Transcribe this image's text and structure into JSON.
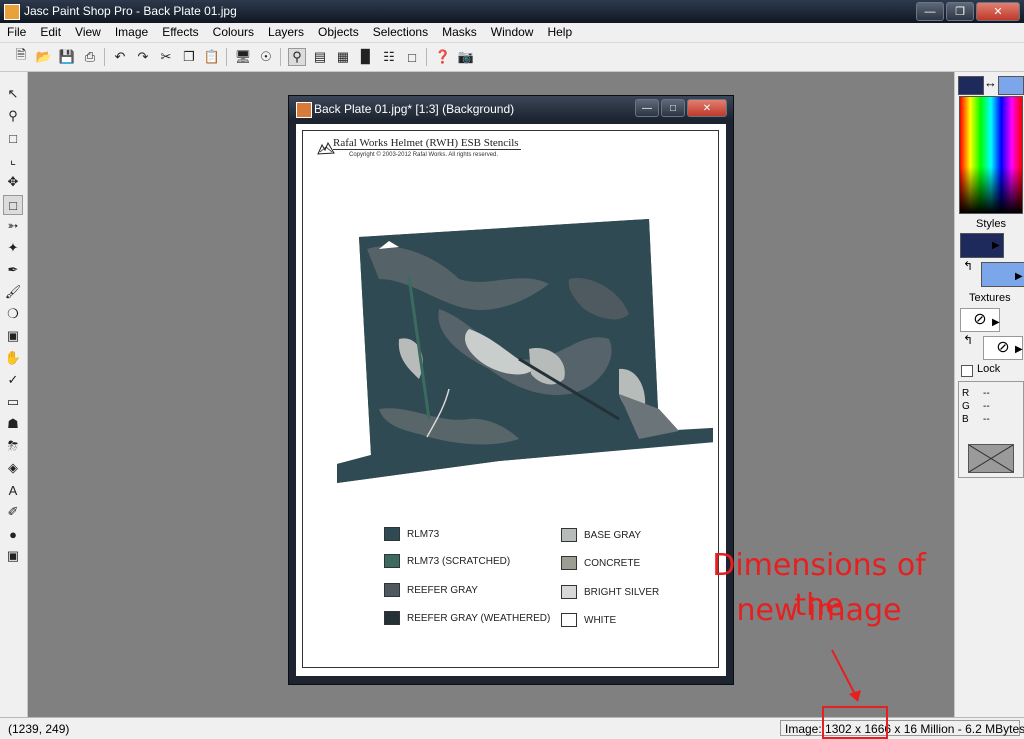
{
  "window": {
    "title": "Jasc Paint Shop Pro - Back Plate 01.jpg"
  },
  "menu": [
    "File",
    "Edit",
    "View",
    "Image",
    "Effects",
    "Colours",
    "Layers",
    "Objects",
    "Selections",
    "Masks",
    "Window",
    "Help"
  ],
  "document": {
    "title": "Back Plate 01.jpg* [1:3] (Background)",
    "heading": "Rafal Works Helmet (RWH) ESB Stencils",
    "copyright": "Copyright © 2003-2012 Rafal Works. All rights reserved.",
    "legend_left": [
      {
        "label": "RLM73",
        "color": "#2f4a52"
      },
      {
        "label": "RLM73 (SCRATCHED)",
        "color": "#3b6b5e"
      },
      {
        "label": "REEFER GRAY",
        "color": "#4e5860"
      },
      {
        "label": "REEFER GRAY (WEATHERED)",
        "color": "#243238"
      }
    ],
    "legend_right": [
      {
        "label": "BASE GRAY",
        "color": "#b7bcba"
      },
      {
        "label": "CONCRETE",
        "color": "#9c9e91"
      },
      {
        "label": "BRIGHT SILVER",
        "color": "#d8d8d8"
      },
      {
        "label": "WHITE",
        "color": "#ffffff"
      }
    ]
  },
  "palette": {
    "foreground_color": "#1f2a5c",
    "background_color": "#7ba7ea",
    "styles_label": "Styles",
    "textures_label": "Textures",
    "lock_label": "Lock",
    "rgb": [
      {
        "k": "R",
        "v": "--"
      },
      {
        "k": "G",
        "v": "--"
      },
      {
        "k": "B",
        "v": "--"
      }
    ]
  },
  "status": {
    "coords": "(1239, 249)",
    "image_info": "Image: 1302 x 1666 x 16 Million - 6.2 MBytes"
  },
  "annotation": {
    "line1": "Dimensions of the",
    "line2": "new image",
    "color": "#e62020"
  }
}
